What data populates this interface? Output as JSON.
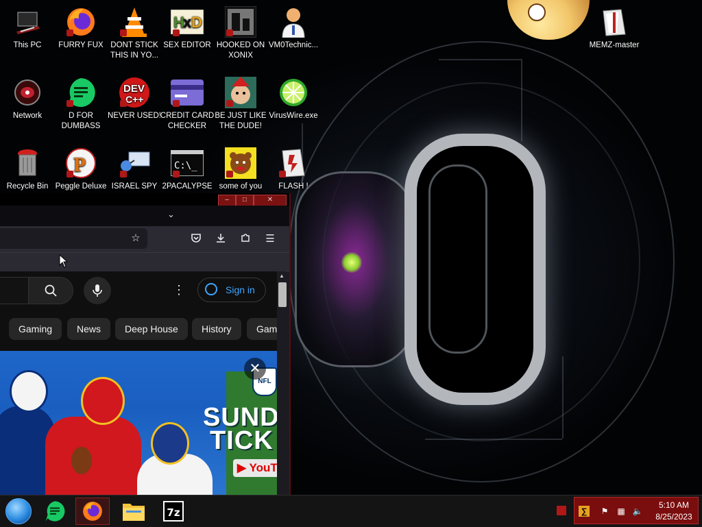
{
  "desktop": {
    "icons": [
      {
        "label": "This PC",
        "icon": "this-pc-icon"
      },
      {
        "label": "FURRY FUX",
        "icon": "firefox-icon"
      },
      {
        "label": "DONT STICK THIS IN YO...",
        "icon": "vlc-cone-icon"
      },
      {
        "label": "SEX EDITOR",
        "icon": "hxd-editor-icon"
      },
      {
        "label": "HOOKED ON XONIX",
        "icon": "xonix-game-icon"
      },
      {
        "label": "VM0Technic...",
        "icon": "technician-icon"
      },
      {
        "label": "MEMZ-master",
        "icon": "zip-folder-icon"
      },
      {
        "label": "Network",
        "icon": "network-icon"
      },
      {
        "label": "D FOR DUMBASS",
        "icon": "discord-like-icon"
      },
      {
        "label": "NEVER USED!",
        "icon": "dev-cpp-icon"
      },
      {
        "label": "CREDIT CARD CHECKER",
        "icon": "credit-card-icon"
      },
      {
        "label": "BE JUST LIKE THE DUDE!",
        "icon": "elf-icon"
      },
      {
        "label": "VirusWire.exe",
        "icon": "lime-icon"
      },
      {
        "label": "Recycle Bin",
        "icon": "recycle-bin-icon"
      },
      {
        "label": "Peggle Deluxe",
        "icon": "peggle-icon"
      },
      {
        "label": "ISRAEL SPY",
        "icon": "spy-tool-icon"
      },
      {
        "label": "2PACALYPSE",
        "icon": "terminal-icon"
      },
      {
        "label": "some of you",
        "icon": "bear-icon"
      },
      {
        "label": "FLASH !",
        "icon": "flash-icon"
      }
    ]
  },
  "browser": {
    "tab_overflow_icon": "chevron-down-icon",
    "toolbar_icons": [
      "bookmark-star-icon",
      "pocket-icon",
      "download-icon",
      "extensions-icon",
      "menu-icon"
    ],
    "youtube": {
      "search_icon": "search-icon",
      "mic_icon": "microphone-icon",
      "more_icon": "more-vertical-icon",
      "sign_in_label": "Sign in",
      "chips": [
        "Gaming",
        "News",
        "Deep House",
        "History",
        "Gam"
      ],
      "banner": {
        "headline_1": "SUND",
        "headline_2": "TICK",
        "youtube_text": "YouT",
        "nfl_badge": "NFL",
        "close_icon": "close-icon"
      }
    }
  },
  "taskbar": {
    "apps": [
      {
        "name": "start-orb",
        "active": false
      },
      {
        "name": "discord-like-app",
        "active": false
      },
      {
        "name": "firefox",
        "active": true
      },
      {
        "name": "file-explorer",
        "active": false
      },
      {
        "name": "7-zip",
        "active": false,
        "text": "7z"
      }
    ],
    "tray": {
      "time": "5:10 AM",
      "date": "8/25/2023"
    }
  },
  "colors": {
    "window_accent": "#7a1212",
    "tray_bg": "#7a0d0d",
    "youtube_link": "#3ea6ff"
  }
}
